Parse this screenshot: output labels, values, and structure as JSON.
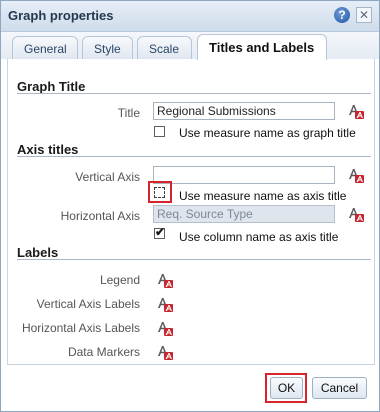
{
  "dialog": {
    "title": "Graph properties",
    "help_icon": "?",
    "close_icon": "✕"
  },
  "tabs": [
    {
      "label": "General"
    },
    {
      "label": "Style"
    },
    {
      "label": "Scale"
    },
    {
      "label": "Titles and Labels",
      "active": true
    }
  ],
  "graph_title": {
    "heading": "Graph Title",
    "title_label": "Title",
    "title_value": "Regional Submissions",
    "use_measure_label": "Use measure name as graph title",
    "use_measure_checked": false
  },
  "axis_titles": {
    "heading": "Axis titles",
    "vertical_label": "Vertical Axis",
    "vertical_value": "",
    "vertical_use_measure_label": "Use measure name as axis title",
    "vertical_use_measure_checked": false,
    "horizontal_label": "Horizontal Axis",
    "horizontal_value": "Req. Source Type",
    "horizontal_use_column_label": "Use column name as axis title",
    "horizontal_use_column_checked": true
  },
  "labels": {
    "heading": "Labels",
    "items": [
      {
        "label": "Legend"
      },
      {
        "label": "Vertical Axis Labels"
      },
      {
        "label": "Horizontal Axis Labels"
      },
      {
        "label": "Data Markers"
      }
    ]
  },
  "footer": {
    "ok_label": "OK",
    "cancel_label": "Cancel"
  },
  "icons": {
    "format": "format-font-icon"
  },
  "colors": {
    "highlight": "#d8232a",
    "titlebar": "#cfdceb"
  }
}
